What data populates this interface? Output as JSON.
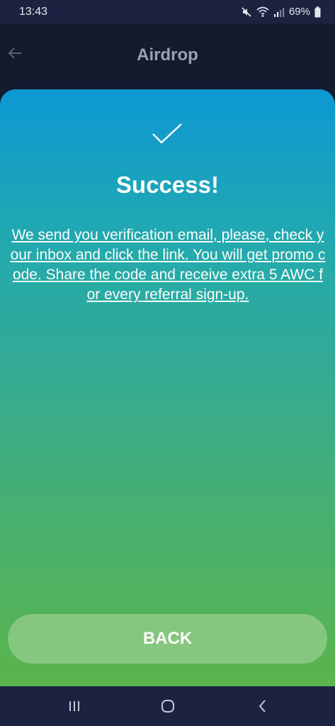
{
  "status_bar": {
    "time": "13:43",
    "battery": "69%",
    "icons": [
      "mute-icon",
      "wifi-icon",
      "signal-icon",
      "battery-icon"
    ]
  },
  "app_bar": {
    "title": "Airdrop",
    "back_icon": "arrow-left-icon"
  },
  "card": {
    "icon": "checkmark-icon",
    "title": "Success!",
    "message": "We send you verification email, please, check your inbox and click the link. You will get promo code. Share the code and receive extra 5 AWC for every referral sign-up.",
    "button_label": "BACK"
  },
  "nav_bar": {
    "buttons": [
      "recents-icon",
      "home-icon",
      "back-icon"
    ]
  },
  "colors": {
    "gradient_top": "#0c98d3",
    "gradient_bottom": "#5ab54c",
    "button_bg": "#86c77f",
    "app_bar_bg": "#161a2e"
  }
}
